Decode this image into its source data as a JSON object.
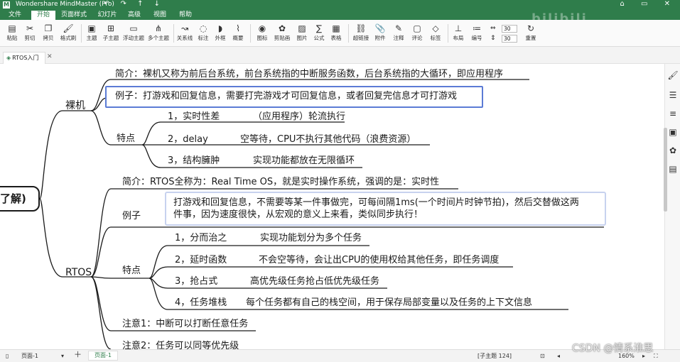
{
  "titlebar": {
    "app_icon": "M",
    "title": "Wondershare MindMaster (Pro)",
    "quick_access": "↶ ↷ ↑ ↓",
    "window_controls": "⌂ ▭ ✕"
  },
  "menu": [
    "文件",
    "开始",
    "页面样式",
    "幻灯片",
    "高级",
    "视图",
    "帮助"
  ],
  "menu_active": "开始",
  "watermark_top": "bilibili",
  "ribbon": {
    "buttons": [
      {
        "label": "粘贴",
        "icon": "▤"
      },
      {
        "label": "剪切",
        "icon": "✂"
      },
      {
        "label": "拷贝",
        "icon": "❐"
      },
      {
        "label": "格式刷",
        "icon": "🖌"
      },
      {
        "label": "主题",
        "icon": "▣"
      },
      {
        "label": "子主题",
        "icon": "⊞"
      },
      {
        "label": "浮动主题",
        "icon": "▭"
      },
      {
        "label": "多个主题",
        "icon": "⋔"
      },
      {
        "label": "关系线",
        "icon": "↝"
      },
      {
        "label": "标注",
        "icon": "◌"
      },
      {
        "label": "外框",
        "icon": "◗"
      },
      {
        "label": "概要",
        "icon": "⌇"
      },
      {
        "label": "图标",
        "icon": "◉"
      },
      {
        "label": "剪贴画",
        "icon": "✿"
      },
      {
        "label": "图片",
        "icon": "▨"
      },
      {
        "label": "公式",
        "icon": "∑"
      },
      {
        "label": "表格",
        "icon": "▦"
      },
      {
        "label": "超链接",
        "icon": "⛓"
      },
      {
        "label": "附件",
        "icon": "📎"
      },
      {
        "label": "注释",
        "icon": "✎"
      },
      {
        "label": "评论",
        "icon": "▢"
      },
      {
        "label": "标签",
        "icon": "◇"
      },
      {
        "label": "布局",
        "icon": "⊥"
      },
      {
        "label": "编号",
        "icon": "≔"
      }
    ],
    "spacing_h": "30",
    "spacing_v": "30",
    "reset_label": "重置",
    "reset_icon": "↻"
  },
  "document_tab": {
    "icon": "◈",
    "label": "RTOS入门",
    "close": "✕"
  },
  "mindmap": {
    "root": "了解)",
    "bare_metal": {
      "label": "裸机",
      "intro": "简介：裸机又称为前后台系统，前台系统指的中断服务函数，后台系统指的大循环，即应用程序",
      "example": "例子：打游戏和回复信息，需要打完游戏才可回复信息，或者回复完信息才可打游戏",
      "features_label": "特点",
      "features": [
        {
          "name": "1，实时性差",
          "desc": "（应用程序）轮流执行"
        },
        {
          "name": "2，delay",
          "desc": "空等待，CPU不执行其他代码（浪费资源）"
        },
        {
          "name": "3，结构臃肿",
          "desc": "实现功能都放在无限循环"
        }
      ]
    },
    "rtos": {
      "label": "RTOS",
      "intro": "简介：RTOS全称为：Real Time OS，就是实时操作系统，强调的是：实时性",
      "example_label": "例子",
      "example_line1": "打游戏和回复信息，不需要等某一件事做完，可每间隔1ms(一个时间片时钟节拍)，然后交替做这两",
      "example_line2": "件事，因为速度很快，从宏观的意义上来看，类似同步执行！",
      "features_label": "特点",
      "features": [
        {
          "name": "1，分而治之",
          "desc": "实现功能划分为多个任务"
        },
        {
          "name": "2，延时函数",
          "desc": "不会空等待，会让出CPU的使用权给其他任务，即任务调度"
        },
        {
          "name": "3，抢占式",
          "desc": "高优先级任务抢占低优先级任务"
        },
        {
          "name": "4，任务堆栈",
          "desc": "每个任务都有自己的栈空间，用于保存局部变量以及任务的上下文信息"
        }
      ],
      "note1": "注意1：中断可以打断任意任务",
      "note2": "注意2：任务可以同等优先级"
    }
  },
  "sidebar_icons": [
    "brush-icon",
    "list-icon",
    "outline-icon",
    "image-icon",
    "clipart-icon",
    "task-icon"
  ],
  "status": {
    "page_label": "页面-1",
    "page_tab": "页面-1",
    "add": "＋",
    "topic_count": "[子主题 124]",
    "zoom": "160%",
    "nav_left": "◂",
    "nav_right": "▸"
  },
  "watermark_csdn": "CSDN @情系淮思"
}
